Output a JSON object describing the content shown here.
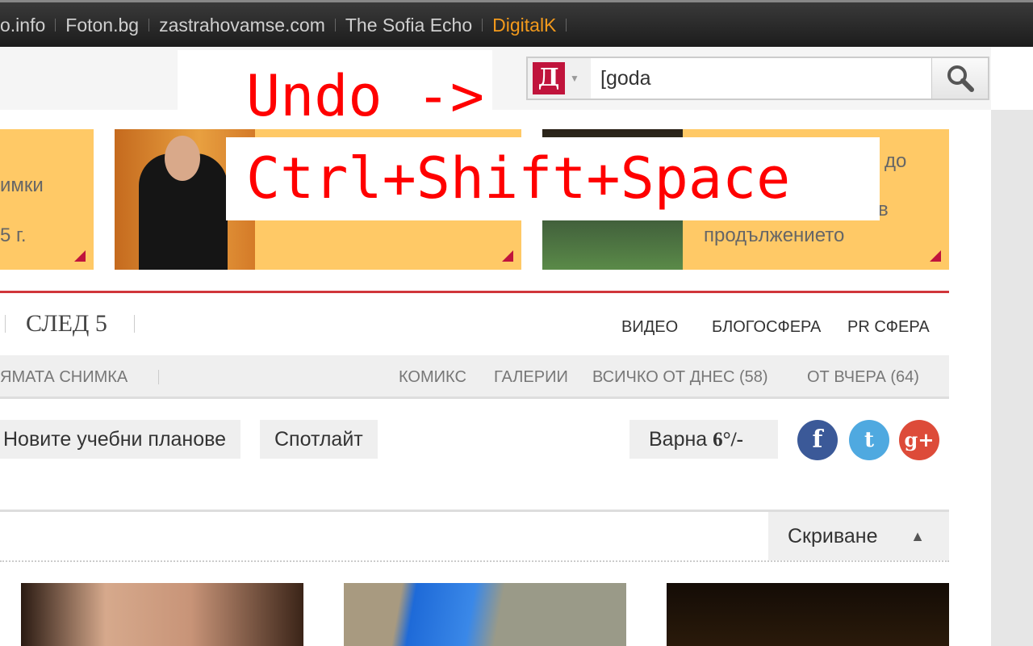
{
  "topbar": {
    "links": [
      "o.info",
      "Foton.bg",
      "zastrahovamse.com",
      "The Sofia Echo",
      "DigitalK"
    ],
    "accent": "#f39a1c"
  },
  "search": {
    "logo": "Д",
    "value": "[goda",
    "icon": "search-icon"
  },
  "cards": [
    {
      "lines": [
        "имки",
        "5 г."
      ]
    },
    {
      "lines": []
    },
    {
      "lines": [
        "до",
        "в",
        "продължението"
      ]
    }
  ],
  "nav1": {
    "left": "СЛЕД 5",
    "right": [
      "ВИДЕО",
      "БЛОГОСФЕРА",
      "PR СФЕРА"
    ]
  },
  "nav2": {
    "left": "ЯМАТА СНИМКА",
    "right": [
      "КОМИКС",
      "ГАЛЕРИИ",
      "ВСИЧКО ОТ ДНЕС (58)",
      "ОТ ВЧЕРА (64)"
    ]
  },
  "tags": [
    "Новите учебни планове",
    "Спотлайт"
  ],
  "weather": {
    "city": "Варна",
    "temp": "6°/-"
  },
  "social": [
    {
      "name": "facebook",
      "glyph": "f",
      "color": "#3b5998"
    },
    {
      "name": "twitter",
      "glyph": "t",
      "color": "#4fa9e0"
    },
    {
      "name": "google-plus",
      "glyph": "g+",
      "color": "#dd4b39"
    }
  ],
  "hide_label": "Скриване",
  "overlay": {
    "line1": "Undo ->",
    "line2": "Ctrl+Shift+Space",
    "color": "#ff0000"
  }
}
